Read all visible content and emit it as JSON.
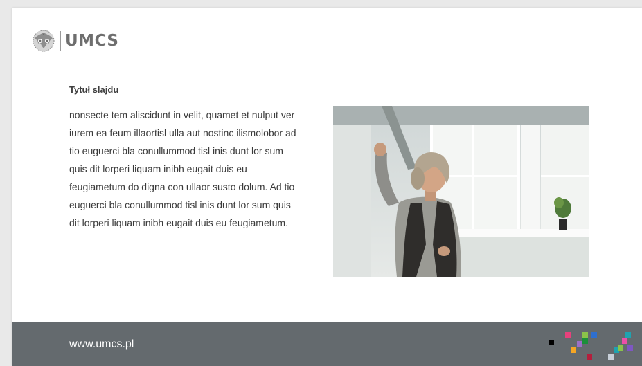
{
  "logo": {
    "text": "UMCS",
    "emblem": "eagle-emblem-icon"
  },
  "slide": {
    "title": "Tytuł slajdu",
    "body": "nonsecte tem aliscidunt in velit, quamet et nulput ver iurem ea feum illaortisl ulla aut nostinc ilismolobor ad tio euguerci bla conullummod tisl inis dunt lor sum quis dit lorperi liquam inibh eugait duis eu feugiametum do digna con ullaor susto dolum. Ad tio euguerci bla conullummod tisl inis dunt lor sum quis dit lorperi liquam inibh eugait duis eu feugiametum.",
    "image": "photo-woman-raising-fist"
  },
  "footer": {
    "url": "www.umcs.pl",
    "background": "#646a6e",
    "pixel_colors": [
      "#000000",
      "#e8417c",
      "#f5a623",
      "#8bc34a",
      "#9b6fc7",
      "#1b8f3a",
      "#2e6fd0",
      "#b41e3c",
      "#c7cfd8",
      "#1fa3b0",
      "#ec4fa8",
      "#7e57c2"
    ]
  }
}
